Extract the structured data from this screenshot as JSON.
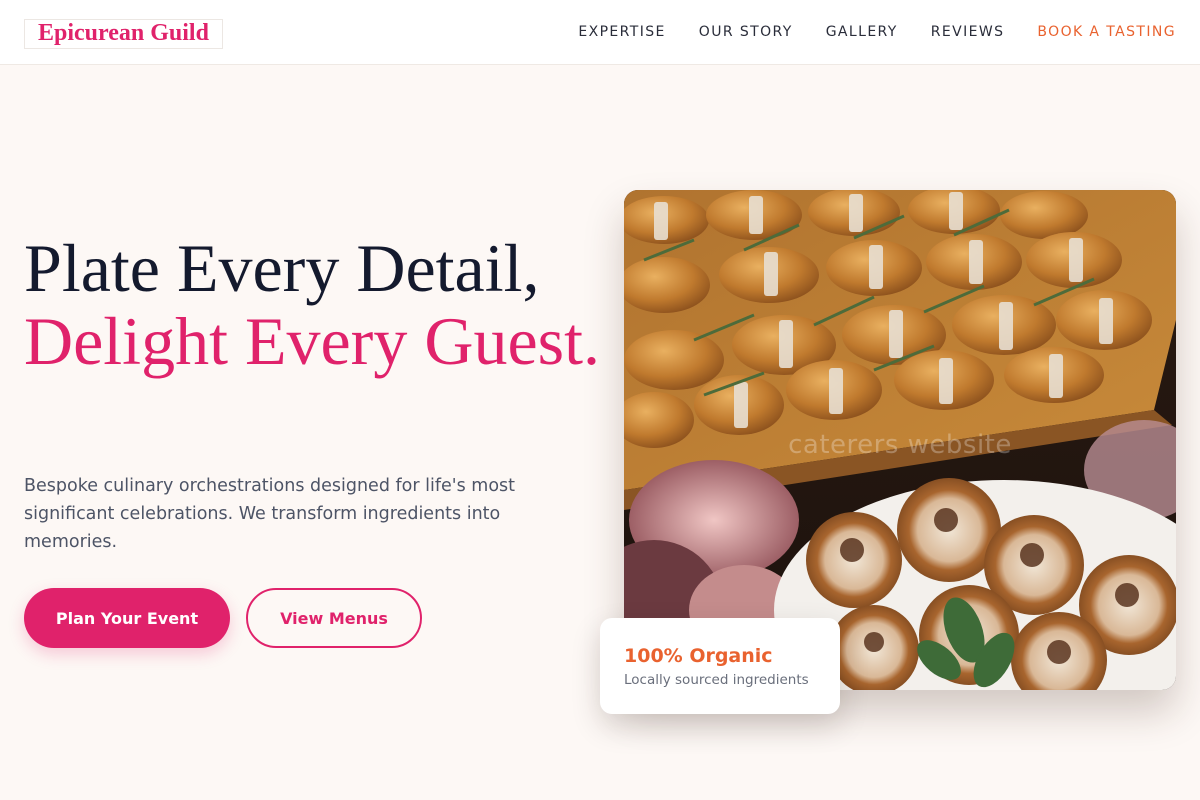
{
  "header": {
    "logo": "Epicurean Guild",
    "nav": [
      {
        "label": "EXPERTISE"
      },
      {
        "label": "OUR STORY"
      },
      {
        "label": "GALLERY"
      },
      {
        "label": "REVIEWS"
      },
      {
        "label": "BOOK A TASTING"
      }
    ]
  },
  "hero": {
    "headline_line1": "Plate Every Detail,",
    "headline_line2": "Delight Every Guest.",
    "subtext": "Bespoke culinary orchestrations designed for life's most significant celebrations. We transform ingredients into memories.",
    "primary_button": "Plan Your Event",
    "secondary_button": "View Menus",
    "image_watermark": "caterers website"
  },
  "badge": {
    "title": "100% Organic",
    "subtitle": "Locally sourced ingredients"
  },
  "colors": {
    "accent_pink": "#e0226b",
    "accent_orange": "#e9622f",
    "background": "#fdf8f5",
    "heading_dark": "#141a2e"
  }
}
